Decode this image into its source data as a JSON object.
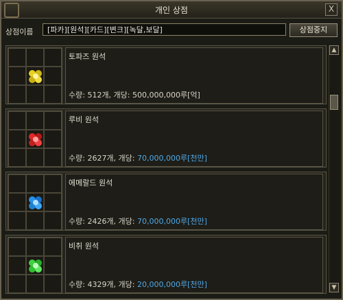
{
  "window": {
    "title": "개인 상점",
    "close_label": "X"
  },
  "shop": {
    "name_label": "상점이름",
    "name_value": "[파카][원석][카드][변크][녹달,보달]",
    "stop_button": "상점중지"
  },
  "items": [
    {
      "name": "토파즈 원석",
      "qty_prefix": "수량: 512개, 개당: ",
      "price": "500,000,000루[억]",
      "gem_icon": "topaz-gem-icon",
      "gem_color": "#e8d020",
      "price_highlight": false
    },
    {
      "name": "루비 원석",
      "qty_prefix": "수량: 2627개, 개당: ",
      "price": "70,000,000루[천만]",
      "gem_icon": "ruby-gem-icon",
      "gem_color": "#e02828",
      "price_highlight": true
    },
    {
      "name": "에메랄드 원석",
      "qty_prefix": "수량: 2426개, 개당: ",
      "price": "70,000,000루[천만]",
      "gem_icon": "sapphire-gem-icon",
      "gem_color": "#2890e8",
      "price_highlight": true
    },
    {
      "name": "비취 원석",
      "qty_prefix": "수량: 4329개, 개당: ",
      "price": "20,000,000루[천만]",
      "gem_icon": "jade-gem-icon",
      "gem_color": "#40d040",
      "price_highlight": true
    }
  ],
  "colors": {
    "price_blue": "#4fa8e8",
    "frame": "#6a6252"
  }
}
